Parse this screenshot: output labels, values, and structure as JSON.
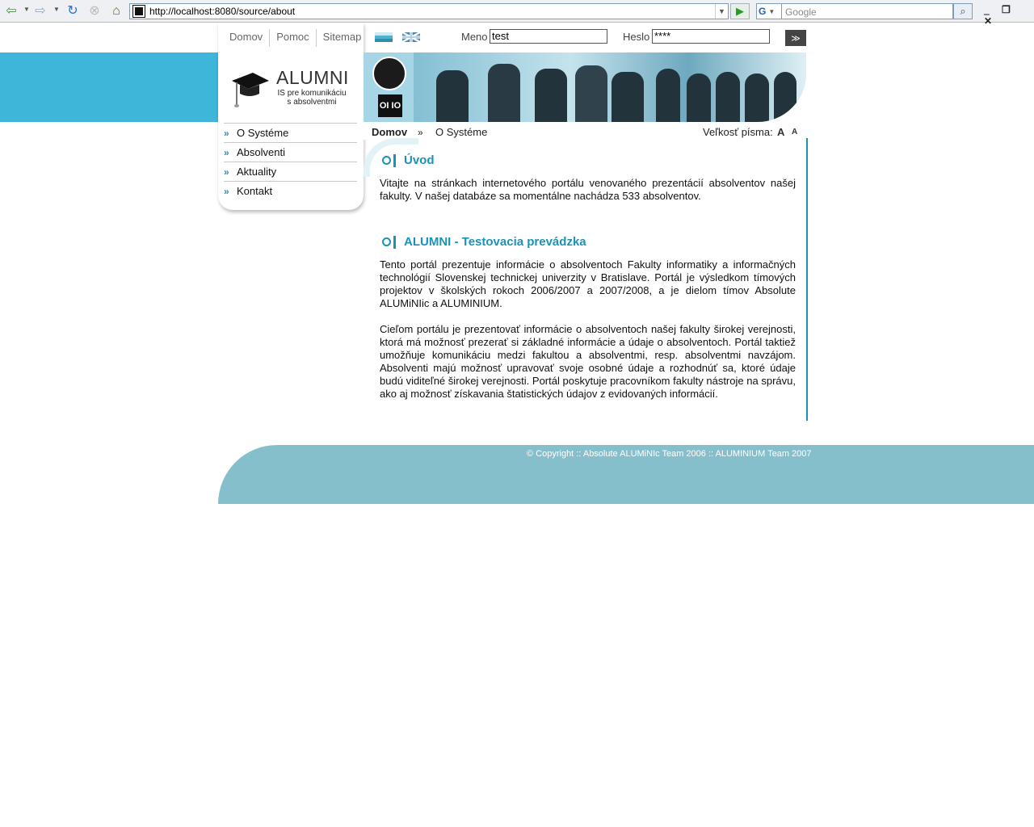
{
  "browser": {
    "url": "http://localhost:8080/source/about",
    "search_placeholder": "Google",
    "search_engine_glyph": "G"
  },
  "topnav": [
    {
      "label": "Domov"
    },
    {
      "label": "Pomoc"
    },
    {
      "label": "Sitemap"
    }
  ],
  "logo": {
    "title": "ALUMNI",
    "subtitle_line1": "IS pre komunikáciu",
    "subtitle_line2": "s absolventmi"
  },
  "login": {
    "username_label": "Meno",
    "username_value": "test",
    "password_label": "Heslo",
    "password_value": "****",
    "submit_glyph": "≫"
  },
  "banner": {
    "logo_text": "OI IO"
  },
  "sidebar": {
    "items": [
      {
        "label": "O Systéme"
      },
      {
        "label": "Absolventi"
      },
      {
        "label": "Aktuality"
      },
      {
        "label": "Kontakt"
      }
    ]
  },
  "breadcrumb": {
    "home": "Domov",
    "separator": "»",
    "current": "O Systéme"
  },
  "fontsize": {
    "label": "Veľkosť písma:",
    "larger": "A",
    "smaller": "A"
  },
  "sections": [
    {
      "title": "Úvod",
      "paragraphs": [
        "Vitajte na stránkach internetového portálu venovaného prezentácií absolventov našej fakulty. V našej databáze sa momentálne nachádza 533 absolventov."
      ]
    },
    {
      "title": "ALUMNI - Testovacia prevádzka",
      "paragraphs": [
        "Tento portál prezentuje informácie o absolventoch Fakulty informatiky a informačných technológií Slovenskej technickej univerzity v Bratislave. Portál je výsledkom tímových projektov v školských rokoch 2006/2007 a 2007/2008, a je dielom tímov Absolute ALUMiNIic a ALUMINIUM.",
        "Cieľom portálu je prezentovať informácie o absolventoch našej fakulty širokej verejnosti, ktorá má možnosť prezerať si základné informácie a údaje o absolventoch. Portál taktiež umožňuje komunikáciu medzi fakultou a absolventmi, resp. absolventmi navzájom. Absolventi majú možnosť upravovať svoje osobné údaje a rozhodnúť sa, ktoré údaje budú viditeľné širokej verejnosti. Portál poskytuje pracovníkom fakulty nástroje na správu, ako aj možnosť získavania štatistických údajov z evidovaných informácií."
      ]
    }
  ],
  "footer": {
    "copyright": "© Copyright :: Absolute ALUMiNIc Team 2006 :: ALUMINIUM Team 2007"
  },
  "colors": {
    "accent": "#1b92b8",
    "band": "#3eb6d9",
    "footer": "#86bfcc"
  }
}
